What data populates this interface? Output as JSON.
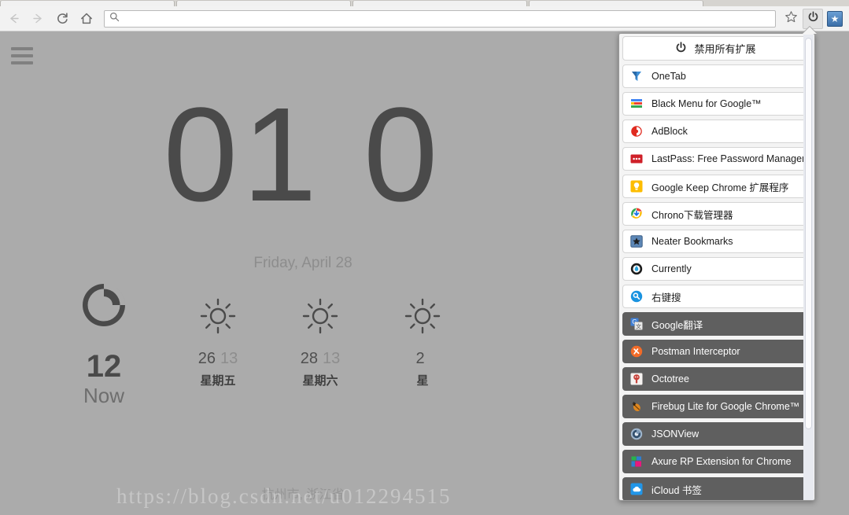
{
  "browser": {
    "nav": {
      "back": "back-arrow",
      "forward": "forward-arrow",
      "reload": "reload",
      "home": "home"
    },
    "omnibox": {
      "value": "",
      "placeholder": "",
      "icon": "search-icon"
    },
    "actions": {
      "bookmark_star": "star-outline-icon",
      "extension_power": "power-icon",
      "neater_bookmarks": "blue-star-icon"
    }
  },
  "page": {
    "menu_icon": "hamburger-icon",
    "clock": {
      "hours": "01",
      "separator": ":",
      "minutes_visible": "0"
    },
    "date": "Friday, April 28",
    "weather": {
      "now": {
        "icon": "moon-icon",
        "temp": "12",
        "label": "Now"
      },
      "forecast": [
        {
          "icon": "sun-icon",
          "high": "26",
          "low": "13",
          "day": "星期五"
        },
        {
          "icon": "sun-icon",
          "high": "28",
          "low": "13",
          "day": "星期六"
        },
        {
          "icon": "sun-icon",
          "high": "2",
          "low": "",
          "day": "星"
        }
      ],
      "location": "杭州市, 浙江省"
    },
    "watermark": "https://blog.csdn.net/u012294515"
  },
  "extension_popup": {
    "header": {
      "icon": "power-icon",
      "label": "禁用所有扩展"
    },
    "items": [
      {
        "label": "OneTab",
        "icon": "onetab-icon",
        "state": "enabled"
      },
      {
        "label": "Black Menu for Google™",
        "icon": "blackmenu-icon",
        "state": "enabled"
      },
      {
        "label": "AdBlock",
        "icon": "adblock-icon",
        "state": "enabled"
      },
      {
        "label": "LastPass: Free Password Manager",
        "icon": "lastpass-icon",
        "state": "enabled"
      },
      {
        "label": "Google Keep Chrome 扩展程序",
        "icon": "keep-icon",
        "state": "enabled"
      },
      {
        "label": "Chrono下载管理器",
        "icon": "chrono-icon",
        "state": "enabled"
      },
      {
        "label": "Neater Bookmarks",
        "icon": "neater-icon",
        "state": "enabled"
      },
      {
        "label": "Currently",
        "icon": "currently-icon",
        "state": "enabled"
      },
      {
        "label": "右键搜",
        "icon": "youjiansou-icon",
        "state": "enabled"
      },
      {
        "label": "Google翻译",
        "icon": "gtranslate-icon",
        "state": "disabled"
      },
      {
        "label": "Postman Interceptor",
        "icon": "postman-icon",
        "state": "disabled"
      },
      {
        "label": "Octotree",
        "icon": "octotree-icon",
        "state": "disabled"
      },
      {
        "label": "Firebug Lite for Google Chrome™",
        "icon": "firebug-icon",
        "state": "disabled"
      },
      {
        "label": "JSONView",
        "icon": "jsonview-icon",
        "state": "disabled"
      },
      {
        "label": "Axure RP Extension for Chrome",
        "icon": "axure-icon",
        "state": "disabled"
      },
      {
        "label": "iCloud 书签",
        "icon": "icloud-icon",
        "state": "disabled"
      }
    ]
  },
  "colors": {
    "page_bg": "#ababab",
    "chrome_bg": "#f2f2f2",
    "popup_enabled_bg": "#ffffff",
    "popup_disabled_bg": "#5f5f5f",
    "clock_text": "#4a4a4a"
  }
}
